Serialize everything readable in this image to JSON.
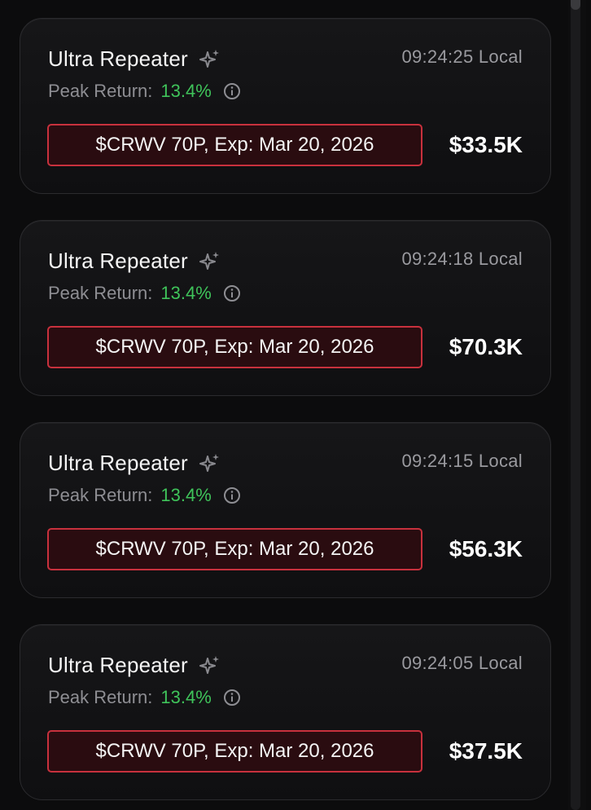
{
  "colors": {
    "background": "#0c0c0d",
    "card_border": "#2b2b2e",
    "positive": "#3fc35a",
    "contract_border": "#c8313d",
    "contract_fill": "#2a0c10"
  },
  "icons": {
    "title": "sparkles-icon",
    "peak": "info-icon"
  },
  "alerts": [
    {
      "title": "Ultra Repeater",
      "time": "09:24:25 Local",
      "peak_label": "Peak Return:",
      "peak_value": "13.4%",
      "contract": "$CRWV 70P, Exp: Mar 20, 2026",
      "amount": "$33.5K"
    },
    {
      "title": "Ultra Repeater",
      "time": "09:24:18 Local",
      "peak_label": "Peak Return:",
      "peak_value": "13.4%",
      "contract": "$CRWV 70P, Exp: Mar 20, 2026",
      "amount": "$70.3K"
    },
    {
      "title": "Ultra Repeater",
      "time": "09:24:15 Local",
      "peak_label": "Peak Return:",
      "peak_value": "13.4%",
      "contract": "$CRWV 70P, Exp: Mar 20, 2026",
      "amount": "$56.3K"
    },
    {
      "title": "Ultra Repeater",
      "time": "09:24:05 Local",
      "peak_label": "Peak Return:",
      "peak_value": "13.4%",
      "contract": "$CRWV 70P, Exp: Mar 20, 2026",
      "amount": "$37.5K"
    }
  ]
}
